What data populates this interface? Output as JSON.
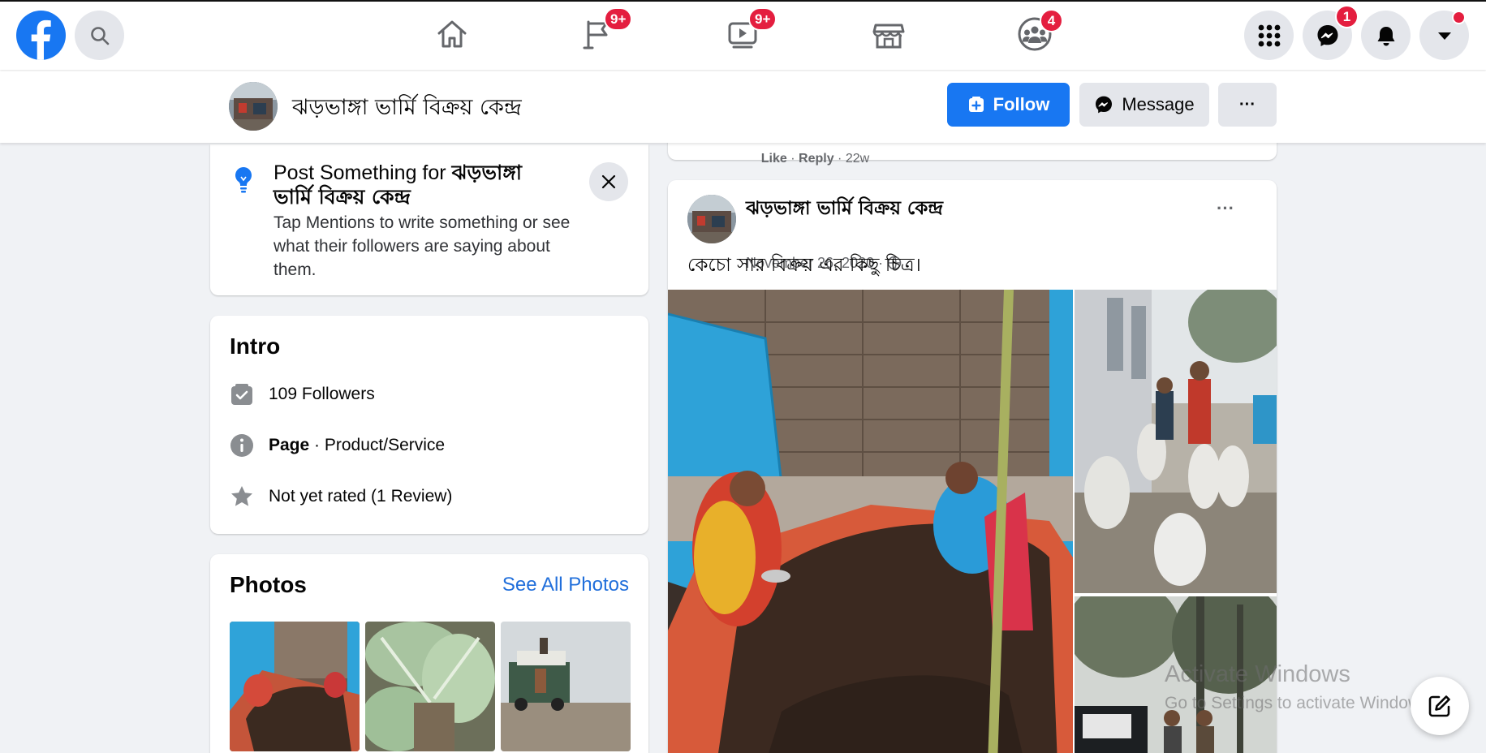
{
  "topbar": {
    "badges": {
      "pages": "9+",
      "watch": "9+",
      "groups": "4",
      "messenger": "1"
    }
  },
  "page_header": {
    "name": "ঝড়ভাঙ্গা ভার্মি বিক্রয় কেন্দ্র",
    "follow_label": "Follow",
    "message_label": "Message",
    "more_label": "···"
  },
  "post_prompt": {
    "title_prefix": "Post Something for ",
    "title_bold": "ঝড়ভাঙ্গা ভার্মি বিক্রয় কেন্দ্র",
    "body": "Tap Mentions to write something or see what their followers are saying about them."
  },
  "intro": {
    "heading": "Intro",
    "followers": "109 Followers",
    "page_bold": "Page",
    "page_rest": " · Product/Service",
    "rating": "Not yet rated (1 Review)"
  },
  "photos": {
    "heading": "Photos",
    "see_all": "See All Photos"
  },
  "prev_comment": {
    "like": "Like",
    "sep1": " · ",
    "reply": "Reply",
    "sep2": " · ",
    "time": "22w"
  },
  "post": {
    "author": "ঝড়ভাঙ্গা ভার্মি বিক্রয় কেন্দ্র",
    "date": "November 26, 2020 · ",
    "text": "কেচো সার বিক্রয় এর কিছু চিত্র।",
    "more_label": "···"
  },
  "watermark": {
    "line1": "Activate Windows",
    "line2": "Go to Settings to activate Windows."
  },
  "colors": {
    "brand": "#1877f2",
    "badge": "#e41e3f",
    "background": "#f0f2f5",
    "link": "#216fdb"
  }
}
